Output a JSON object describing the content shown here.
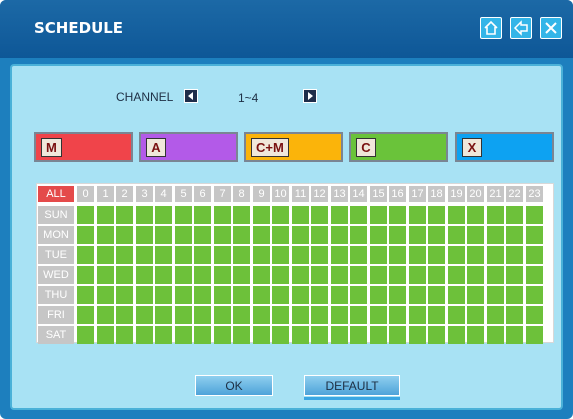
{
  "window": {
    "title": "SCHEDULE"
  },
  "channel": {
    "label": "CHANNEL",
    "value": "1~4"
  },
  "modes": [
    {
      "tag": "M",
      "color": "#f0444a"
    },
    {
      "tag": "A",
      "color": "#b35ae8"
    },
    {
      "tag": "C+M",
      "color": "#fbb40a"
    },
    {
      "tag": "C",
      "color": "#6ac33a"
    },
    {
      "tag": "X",
      "color": "#0da2f2"
    }
  ],
  "grid": {
    "all_label": "ALL",
    "hours": [
      "0",
      "1",
      "2",
      "3",
      "4",
      "5",
      "6",
      "7",
      "8",
      "9",
      "10",
      "11",
      "12",
      "13",
      "14",
      "15",
      "16",
      "17",
      "18",
      "19",
      "20",
      "21",
      "22",
      "23"
    ],
    "days": [
      "SUN",
      "MON",
      "TUE",
      "WED",
      "THU",
      "FRI",
      "SAT"
    ],
    "cell_mode": "C",
    "cell_color": "#6dc13a"
  },
  "buttons": {
    "ok": "OK",
    "default": "DEFAULT"
  },
  "icons": {
    "home": "home-icon",
    "back": "back-arrow-icon",
    "close": "close-icon"
  }
}
